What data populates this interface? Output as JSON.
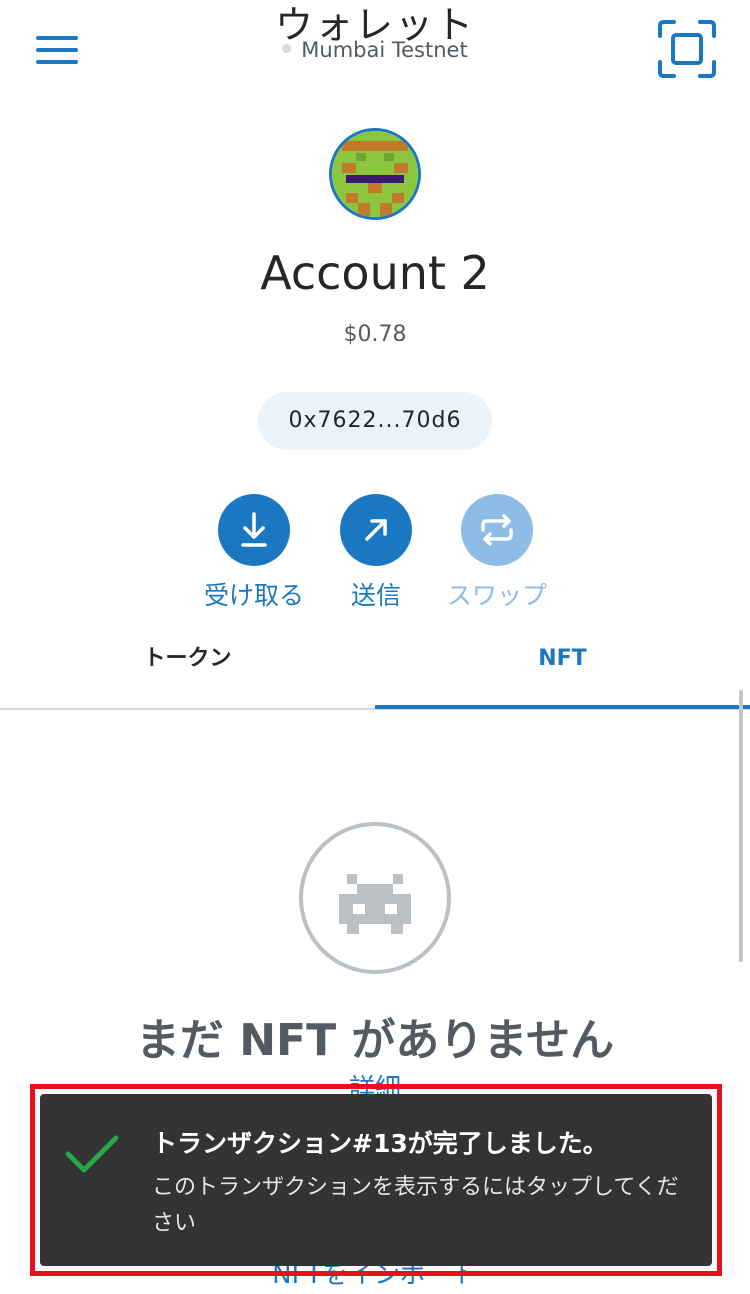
{
  "header": {
    "title": "ウォレット",
    "network": "Mumbai Testnet",
    "menu_icon": "hamburger-menu-icon",
    "scan_icon": "qr-scan-icon"
  },
  "account": {
    "name": "Account 2",
    "balance": "$0.78",
    "address": "0x7622...70d6"
  },
  "actions": [
    {
      "label": "受け取る",
      "icon": "download-icon"
    },
    {
      "label": "送信",
      "icon": "arrow-up-right-icon"
    },
    {
      "label": "スワップ",
      "icon": "swap-arrows-icon"
    }
  ],
  "tabs": [
    {
      "label": "トークン",
      "active": false
    },
    {
      "label": "NFT",
      "active": true
    }
  ],
  "nft_empty": {
    "title": "まだ NFT がありません",
    "learn_more": "詳細",
    "import_link": "NFTをインポート"
  },
  "toast": {
    "title": "トランザクション#13が完了しました。",
    "message": "このトランザクションを表示するにはタップしてください",
    "icon": "checkmark-icon"
  },
  "colors": {
    "accent": "#1a78c2",
    "accent_disabled": "#8dbce6",
    "toast_bg": "#333333",
    "highlight_outline": "#e8101a",
    "success": "#28a745"
  }
}
